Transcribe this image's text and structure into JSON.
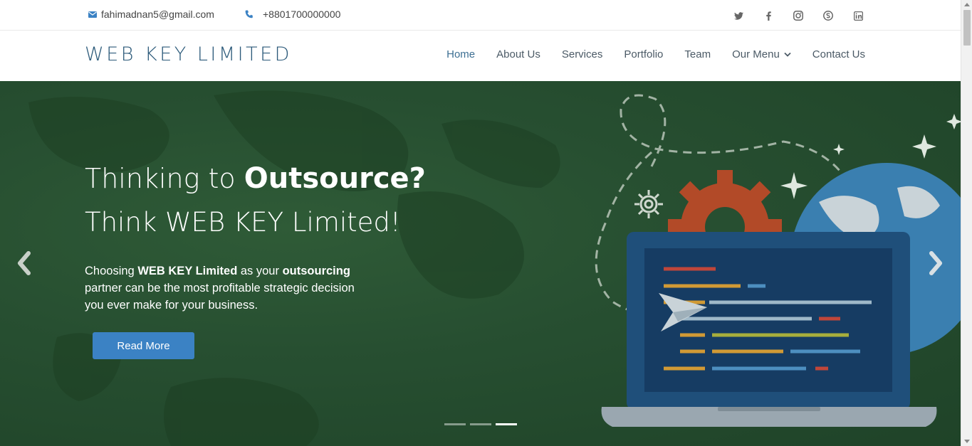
{
  "topbar": {
    "email": "fahimadnan5@gmail.com",
    "phone": "+8801700000000",
    "email_icon": "envelope-icon",
    "phone_icon": "phone-icon",
    "socials": [
      "twitter-icon",
      "facebook-icon",
      "instagram-icon",
      "skype-icon",
      "linkedin-icon"
    ]
  },
  "header": {
    "logo": "WEB KEY LIMITED",
    "nav": [
      {
        "label": "Home",
        "active": true
      },
      {
        "label": "About Us"
      },
      {
        "label": "Services"
      },
      {
        "label": "Portfolio"
      },
      {
        "label": "Team"
      },
      {
        "label": "Our Menu",
        "dropdown": true
      },
      {
        "label": "Contact Us"
      }
    ]
  },
  "hero": {
    "title_prefix": "Thinking to",
    "title_bold": "Outsource?",
    "subtitle": "Think WEB KEY Limited!",
    "text_1": "Choosing",
    "text_bold_1": "WEB KEY Limited",
    "text_2": "as your",
    "text_bold_2": "outsourcing",
    "text_3": "partner can be the most profitable strategic decision you ever make for your business.",
    "button": "Read More",
    "slide_count": 3,
    "active_slide": 3
  },
  "colors": {
    "accent": "#3b82c4",
    "logo": "#2c5a7a",
    "hero_bg": "#274f31"
  }
}
